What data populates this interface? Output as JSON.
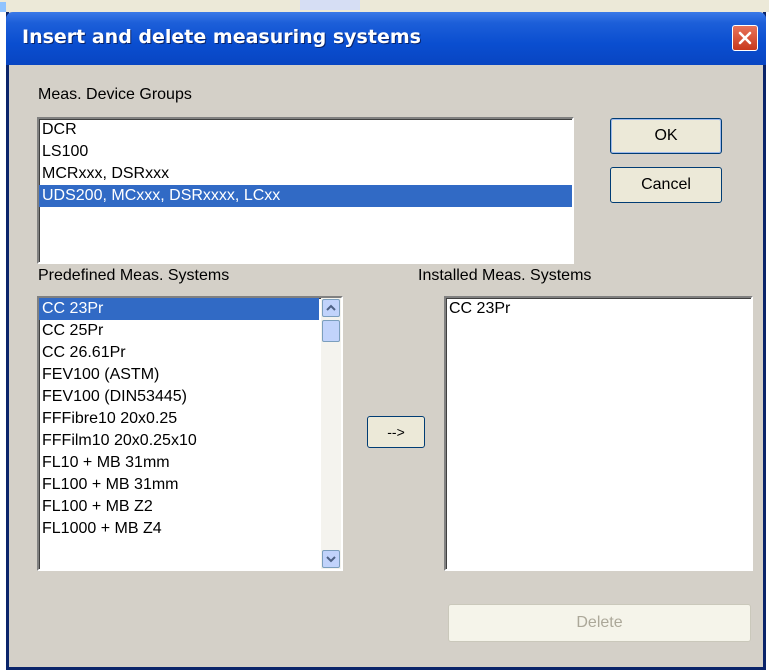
{
  "window": {
    "title": "Insert and delete measuring systems"
  },
  "device_groups": {
    "label": "Meas. Device Groups",
    "items": [
      "DCR",
      "LS100",
      "MCRxxx, DSRxxx",
      "UDS200, MCxxx, DSRxxxx, LCxx"
    ],
    "selected_index": 3
  },
  "predefined": {
    "label": "Predefined Meas. Systems",
    "items": [
      "CC 23Pr",
      "CC 25Pr",
      "CC 26.61Pr",
      "FEV100 (ASTM)",
      "FEV100 (DIN53445)",
      "FFFibre10 20x0.25",
      "FFFilm10 20x0.25x10",
      "FL10 + MB 31mm",
      "FL100 + MB 31mm",
      "FL100 + MB Z2",
      "FL1000 + MB Z4"
    ],
    "selected_index": 0
  },
  "installed": {
    "label": "Installed Meas. Systems",
    "items": [
      "CC 23Pr"
    ]
  },
  "buttons": {
    "ok": "OK",
    "cancel": "Cancel",
    "add": "-->",
    "delete": "Delete"
  },
  "icons": {
    "close": "close-icon",
    "scroll_up": "arrow-up-icon",
    "scroll_down": "arrow-down-icon"
  }
}
